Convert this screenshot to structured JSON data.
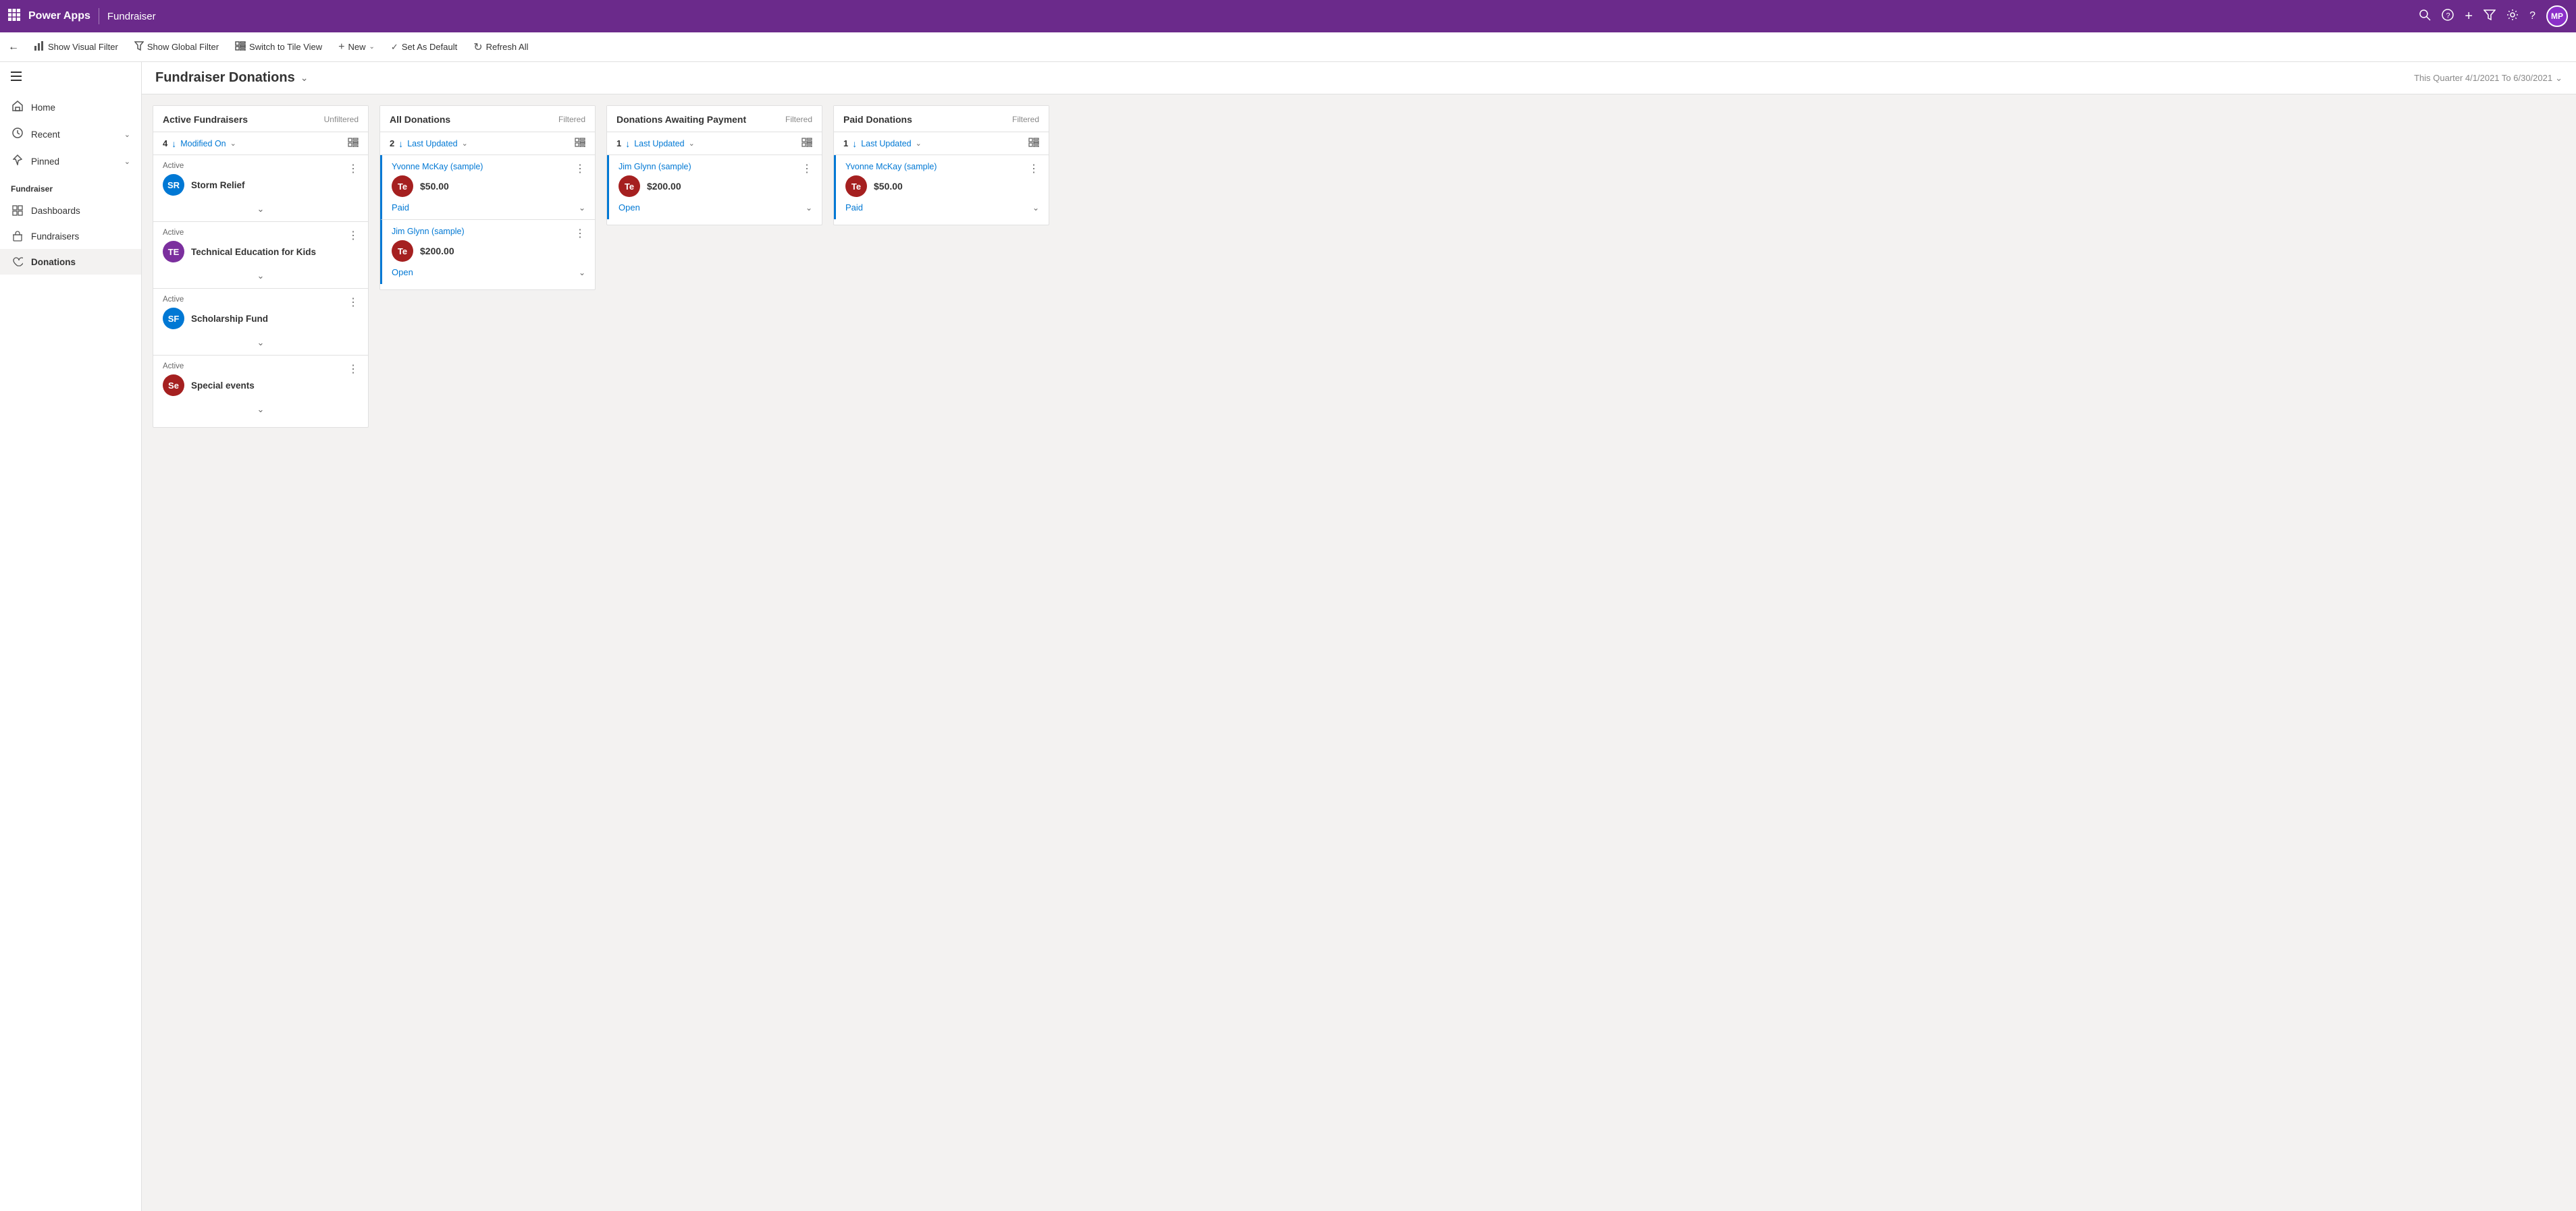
{
  "topBar": {
    "appName": "Power Apps",
    "moduleName": "Fundraiser",
    "avatarInitials": "MP",
    "avatarBg": "#8b4ac7"
  },
  "commandBar": {
    "showVisualFilter": "Show Visual Filter",
    "showGlobalFilter": "Show Global Filter",
    "switchTileView": "Switch to Tile View",
    "new": "New",
    "setAsDefault": "Set As Default",
    "refreshAll": "Refresh All"
  },
  "sidebar": {
    "home": "Home",
    "recent": "Recent",
    "pinned": "Pinned",
    "sectionLabel": "Fundraiser",
    "items": [
      {
        "id": "dashboards",
        "label": "Dashboards"
      },
      {
        "id": "fundraisers",
        "label": "Fundraisers"
      },
      {
        "id": "donations",
        "label": "Donations"
      }
    ]
  },
  "pageHeader": {
    "title": "Fundraiser Donations",
    "dateFilter": "This Quarter 4/1/2021 To 6/30/2021"
  },
  "columns": [
    {
      "id": "active-fundraisers",
      "title": "Active Fundraisers",
      "filter": "Unfiltered",
      "count": 4,
      "sortLabel": "Modified On",
      "cards": [
        {
          "id": "storm-relief",
          "status": "Active",
          "name": "Storm Relief",
          "initials": "SR",
          "avatarBg": "#0078d4"
        },
        {
          "id": "tech-ed-kids",
          "status": "Active",
          "name": "Technical Education for Kids",
          "initials": "TE",
          "avatarBg": "#7b2f9e"
        },
        {
          "id": "scholarship-fund",
          "status": "Active",
          "name": "Scholarship Fund",
          "initials": "SF",
          "avatarBg": "#0078d4"
        },
        {
          "id": "special-events",
          "status": "Active",
          "name": "Special events",
          "initials": "Se",
          "avatarBg": "#a52020"
        }
      ]
    },
    {
      "id": "all-donations",
      "title": "All Donations",
      "filter": "Filtered",
      "count": 2,
      "sortLabel": "Last Updated",
      "cards": [
        {
          "id": "donation-1",
          "donor": "Yvonne McKay (sample)",
          "initials": "Te",
          "avatarBg": "#a52020",
          "amount": "$50.00",
          "status": "Paid",
          "statusType": "paid"
        },
        {
          "id": "donation-2",
          "donor": "Jim Glynn (sample)",
          "initials": "Te",
          "avatarBg": "#a52020",
          "amount": "$200.00",
          "status": "Open",
          "statusType": "open"
        }
      ]
    },
    {
      "id": "donations-awaiting-payment",
      "title": "Donations Awaiting Payment",
      "filter": "Filtered",
      "count": 1,
      "sortLabel": "Last Updated",
      "cards": [
        {
          "id": "awaiting-1",
          "donor": "Jim Glynn (sample)",
          "initials": "Te",
          "avatarBg": "#a52020",
          "amount": "$200.00",
          "status": "Open",
          "statusType": "open"
        }
      ]
    },
    {
      "id": "paid-donations",
      "title": "Paid Donations",
      "filter": "Filtered",
      "count": 1,
      "sortLabel": "Last Updated",
      "cards": [
        {
          "id": "paid-1",
          "donor": "Yvonne McKay (sample)",
          "initials": "Te",
          "avatarBg": "#a52020",
          "amount": "$50.00",
          "status": "Paid",
          "statusType": "paid"
        }
      ]
    }
  ]
}
